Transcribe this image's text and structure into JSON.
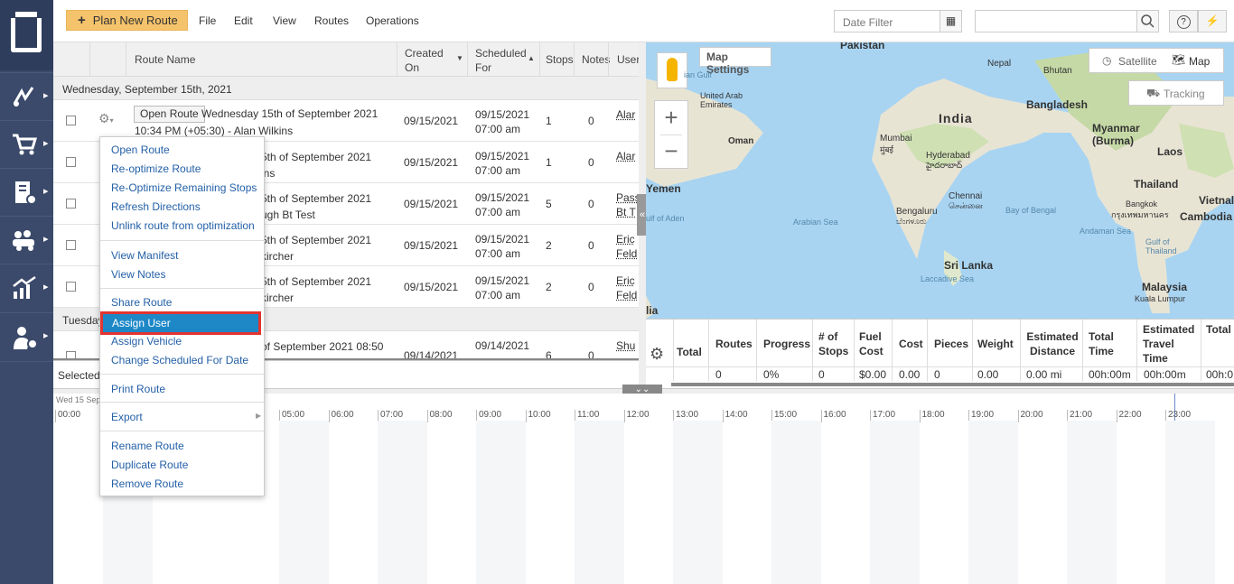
{
  "topbar": {
    "plan_label": "Plan New Route",
    "menus": [
      "File",
      "Edit",
      "View",
      "Routes",
      "Operations"
    ],
    "date_filter_placeholder": "Date Filter"
  },
  "grid": {
    "headers": {
      "route_name": "Route Name",
      "created": "Created On",
      "scheduled": "Scheduled For",
      "stops": "Stops",
      "notes": "Notes",
      "user": "User"
    },
    "group1": "Wednesday, September 15th, 2021",
    "group2": "Tuesday",
    "open_route_btn": "Open Route",
    "rows": [
      {
        "name1": "Wednesday 15th of September 2021",
        "name2": "10:34 PM (+05:30) - Alan Wilkins",
        "created": "09/15/2021",
        "sch1": "09/15/2021",
        "sch2": "07:00 am",
        "stops": "1",
        "notes": "0",
        "user": "Alar"
      },
      {
        "name1": "5th of September 2021",
        "name2": "ins",
        "created": "09/15/2021",
        "sch1": "09/15/2021",
        "sch2": "07:00 am",
        "stops": "1",
        "notes": "0",
        "user": "Alar"
      },
      {
        "name1": "5th of September 2021",
        "name2": "ugh Bt Test",
        "created": "09/15/2021",
        "sch1": "09/15/2021",
        "sch2": "07:00 am",
        "stops": "5",
        "notes": "0",
        "user": "Pass",
        "user2": "Bt T"
      },
      {
        "name1": "5th of September 2021",
        "name2": "kircher",
        "created": "09/15/2021",
        "sch1": "09/15/2021",
        "sch2": "07:00 am",
        "stops": "2",
        "notes": "0",
        "user": "Eric",
        "user2": "Feld"
      },
      {
        "name1": "5th of September 2021",
        "name2": "kircher",
        "created": "09/15/2021",
        "sch1": "09/15/2021",
        "sch2": "07:00 am",
        "stops": "2",
        "notes": "0",
        "user": "Eric",
        "user2": "Feld"
      },
      {
        "name1": "of September 2021 08:50",
        "created": "09/14/2021",
        "sch1": "09/14/2021",
        "stops": "6",
        "notes": "0",
        "user": "Shu"
      }
    ],
    "selected_label": "Selected"
  },
  "context_menu": {
    "items": [
      "Open Route",
      "Re-optimize Route",
      "Re-Optimize Remaining Stops",
      "Refresh Directions",
      "Unlink route from optimization",
      "View Manifest",
      "View Notes",
      "Share Route",
      "Assign User",
      "Assign Vehicle",
      "Change Scheduled For Date",
      "Print Route",
      "Export",
      "Rename Route",
      "Duplicate Route",
      "Remove Route"
    ]
  },
  "map": {
    "settings_label": "Map Settings",
    "satellite_label": "Satellite",
    "map_label": "Map",
    "tracking_label": "Tracking",
    "zoom_in": "+",
    "zoom_out": "−",
    "labels": {
      "pakistan": "Pakistan",
      "nepal": "Nepal",
      "bhutan": "Bhutan",
      "india": "India",
      "bangladesh": "Bangladesh",
      "myanmar": "Myanmar (Burma)",
      "laos": "Laos",
      "thailand": "Thailand",
      "cambodia": "Cambodia",
      "vietnam": "Vietnal",
      "uae": "United Arab Emirates",
      "oman": "Oman",
      "yemen": "Yemen",
      "gulf_aden": "ulf of Aden",
      "arabian_sea": "Arabian Sea",
      "bay_bengal": "Bay of Bengal",
      "andaman": "Andaman Sea",
      "gulf_thailand": "Gulf of Thailand",
      "mumbai": "Mumbai",
      "mumbai2": "मुंबई",
      "hyderabad": "Hyderabad",
      "hyderabad2": "హైదరాబాద్",
      "chennai": "Chennai",
      "chennai2": "சென்னை",
      "bengaluru": "Bengaluru",
      "bengaluru2": "ಬೆಂಗಳೂರು",
      "bangkok": "Bangkok",
      "bangkok2": "กรุงเทพมหานคร",
      "srilanka": "Sri Lanka",
      "laccadive": "Laccadive Sea",
      "malaysia": "Malaysia",
      "kl": "Kuala Lumpur",
      "lia": "lia",
      "ian_gulf": "ian Gulf"
    }
  },
  "stats": {
    "headers": [
      "Total",
      "Routes",
      "Progress",
      "# of Stops",
      "Fuel Cost",
      "Cost",
      "Pieces",
      "Weight",
      "Estimated Distance",
      "Total Time",
      "Estimated Travel Time",
      "Total Service Time"
    ],
    "values": [
      "",
      "0",
      "0%",
      "0",
      "$0.00",
      "0.00",
      "0",
      "0.00",
      "0.00 mi",
      "00h:00m",
      "00h:00m",
      "00h:0"
    ]
  },
  "timeline": {
    "date_label": "Wed 15 Sep",
    "hours": [
      "00:00",
      "05:00",
      "06:00",
      "07:00",
      "08:00",
      "09:00",
      "10:00",
      "11:00",
      "12:00",
      "13:00",
      "14:00",
      "15:00",
      "16:00",
      "17:00",
      "18:00",
      "19:00",
      "20:00",
      "21:00",
      "22:00",
      "23:00"
    ]
  }
}
